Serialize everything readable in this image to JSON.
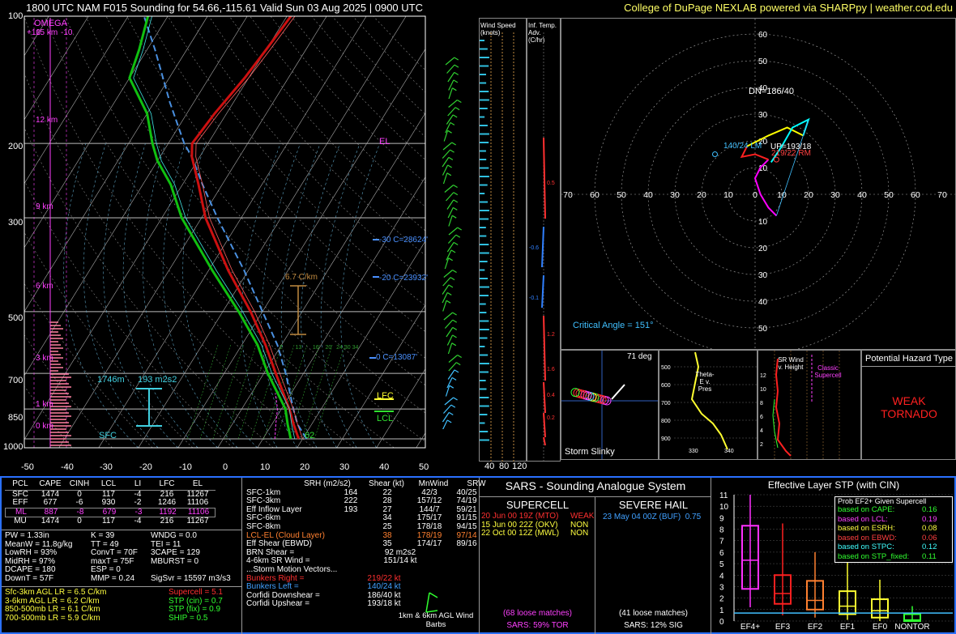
{
  "header": {
    "title": "1800 UTC NAM F015 Sounding for 54.66,-115.61 Valid  Sun 03 Aug 2025 | 0900 UTC",
    "credit": "College of DuPage NEXLAB powered via SHARPpy | weather.cod.edu"
  },
  "colors": {
    "temp": "#cc1010",
    "dew": "#10c010",
    "parcel": "#4a90e0",
    "axis": "#ffffff",
    "gridline": "#cccccc",
    "mixratio": "#30a030",
    "hodo_0_3": "#ff00ff",
    "hodo_3_6": "#ff2020",
    "hodo_6_9": "#ffff00",
    "hodo_9_12": "#00ffff",
    "accent": "#ffff66"
  },
  "skewt": {
    "p_ticks": [
      "100",
      "200",
      "300",
      "500",
      "700",
      "850",
      "1000"
    ],
    "t_ticks": [
      "-50",
      "-40",
      "-30",
      "-20",
      "-10",
      "0",
      "10",
      "20",
      "30",
      "40",
      "50"
    ],
    "height_labels": [
      "15 km",
      "12 km",
      "9 km",
      "6 km",
      "3 km",
      "1 km",
      "0 km"
    ],
    "omega_label": "OMEGA",
    "omega_values": [
      "+10",
      "-10"
    ],
    "lapse_rate": "6.7 C/km",
    "el_label": "EL",
    "lfc_label": "LFC",
    "lcl_label": "LCL",
    "isotherm_labels": [
      "-30 C=28624'",
      "-20 C=23932'",
      "0 C=13087'"
    ],
    "inflow_depth": "1746m",
    "inflow_srh": "193 m2s2",
    "sfc_label": "SFC",
    "sfc_dewpoint": "62",
    "mixratio_labels": [
      "2",
      "4",
      "6",
      "8",
      "10",
      "13",
      "16",
      "20",
      "24",
      "30",
      "34"
    ]
  },
  "windspeed": {
    "title": "Wind Speed (knots)",
    "ticks": [
      "40",
      "80",
      "120"
    ]
  },
  "inftemp": {
    "title": "Inf. Temp. Adv. (C/hr)",
    "values": [
      "0.5",
      "-0.6",
      "-0.1",
      "1.2",
      "1.6",
      "0.4",
      "0.2"
    ]
  },
  "hodograph": {
    "rings": [
      "10",
      "20",
      "30",
      "40",
      "50",
      "60"
    ],
    "x_ticks": [
      "70",
      "60",
      "50",
      "40",
      "30",
      "20",
      "10",
      "0",
      "10",
      "20",
      "30",
      "40",
      "50",
      "60",
      "70"
    ],
    "dn": "DN=186/40",
    "lm": "140/24 LM",
    "up": "UP=193/18",
    "rm": "219/22 RM",
    "mean": "178/19",
    "critical_angle": "Critical Angle = 151°"
  },
  "slinky": {
    "title": "Storm Slinky",
    "angle": "71 deg"
  },
  "thetae": {
    "title": "Theta-E v. Pres",
    "y_ticks": [
      "500",
      "600",
      "700",
      "800",
      "900"
    ],
    "x_ticks": [
      "330",
      "340"
    ]
  },
  "srwind": {
    "title": "SR Wind v. Height",
    "y_ticks": [
      "12",
      "10",
      "8",
      "6",
      "4",
      "2"
    ],
    "classic": "Classic Supercell"
  },
  "hazard": {
    "title": "Potential Hazard Type",
    "value": "WEAK TORNADO"
  },
  "parcels": {
    "headers": [
      "PCL",
      "CAPE",
      "CINH",
      "LCL",
      "LI",
      "LFC",
      "EL"
    ],
    "rows": [
      [
        "SFC",
        "1474",
        "0",
        "117",
        "-4",
        "216",
        "11267"
      ],
      [
        "EFF",
        "677",
        "-6",
        "930",
        "-2",
        "1246",
        "11106"
      ],
      [
        "ML",
        "887",
        "-8",
        "679",
        "-3",
        "1192",
        "11106"
      ],
      [
        "MU",
        "1474",
        "0",
        "117",
        "-4",
        "216",
        "11267"
      ]
    ]
  },
  "indices": {
    "col1": [
      "PW = 1.33in",
      "MeanW = 11.8g/kg",
      "LowRH = 93%",
      "MidRH = 97%",
      "DCAPE = 180",
      "DownT = 57F"
    ],
    "col2": [
      "K = 39",
      "TT = 49",
      "ConvT = 70F",
      "maxT = 75F",
      "ESP = 0",
      "MMP = 0.24"
    ],
    "col3": [
      "WNDG = 0.0",
      "TEI = 11",
      "3CAPE = 129",
      "MBURST = 0",
      "",
      "SigSvr = 15597 m3/s3"
    ]
  },
  "lapse": [
    "Sfc-3km AGL LR = 6.5 C/km",
    "3-6km AGL LR = 6.2 C/km",
    "850-500mb LR = 6.1 C/km",
    "700-500mb LR = 5.9 C/km"
  ],
  "composites": [
    "Supercell = 5.1",
    "STP (cin) = 0.7",
    "STP (fix) = 0.9",
    "SHIP = 0.5"
  ],
  "kinematics": {
    "headers": [
      "SRH (m2/s2)",
      "Shear (kt)",
      "MnWind",
      "SRW"
    ],
    "rows": [
      [
        "SFC-1km",
        "164",
        "22",
        "42/3",
        "40/25"
      ],
      [
        "SFC-3km",
        "222",
        "28",
        "157/12",
        "74/19"
      ],
      [
        "Eff Inflow Layer",
        "193",
        "27",
        "144/7",
        "59/21"
      ],
      [
        "",
        "",
        "",
        "",
        ""
      ],
      [
        "SFC-6km",
        "34",
        "175/17",
        "91/15",
        ""
      ],
      [
        "SFC-8km",
        "25",
        "178/18",
        "94/15",
        ""
      ],
      [
        "LCL-EL (Cloud Layer)",
        "38",
        "178/19",
        "97/14",
        ""
      ],
      [
        "Eff Shear (EBWD)",
        "35",
        "174/17",
        "89/16",
        ""
      ]
    ],
    "brn": "BRN Shear =",
    "brn_val": "92 m2s2",
    "sr46": "4-6km SR Wind =",
    "sr46_val": "151/14 kt",
    "storm_motion": "...Storm Motion Vectors...",
    "bunkers_right": "Bunkers Right =",
    "bunkers_right_val": "219/22 kt",
    "bunkers_left": "Bunkers Left =",
    "bunkers_left_val": "140/24 kt",
    "corfidi_down": "Corfidi Downshear =",
    "corfidi_down_val": "186/40 kt",
    "corfidi_up": "Corfidi Upshear =",
    "corfidi_up_val": "193/18 kt",
    "barbs_label": "1km & 6km AGL Wind Barbs"
  },
  "sars": {
    "title": "SARS - Sounding Analogue System",
    "supercell": "SUPERCELL",
    "hail": "SEVERE HAIL",
    "super_matches": [
      {
        "text": "20 Jun 00 19Z (MTO)",
        "type": "WEAK",
        "color": "#ff3030"
      },
      {
        "text": "15 Jun 00 22Z (OKV)",
        "type": "NON",
        "color": "#ffff40"
      },
      {
        "text": "22 Oct 00 12Z (MWL)",
        "type": "NON",
        "color": "#ffff40"
      }
    ],
    "hail_match": "23 May 04 00Z (BUF)",
    "hail_match_val": "0.75",
    "super_loose": "(68 loose matches)",
    "super_tor": "SARS: 59% TOR",
    "hail_loose": "(41 loose matches)",
    "hail_sig": "SARS: 12% SIG"
  },
  "stp": {
    "title": "Effective Layer STP (with CIN)",
    "y_ticks": [
      "11",
      "10",
      "9",
      "8",
      "7",
      "6",
      "5",
      "4",
      "3",
      "2",
      "1",
      "0"
    ],
    "categories": [
      "EF4+",
      "EF3",
      "EF2",
      "EF1",
      "EF0",
      "NONTOR"
    ],
    "prob_title": "Prob EF2+ Given Supercell",
    "prob_rows": [
      {
        "label": "based on CAPE:",
        "value": "0.16",
        "color": "#30ff30"
      },
      {
        "label": "based on LCL:",
        "value": "0.19",
        "color": "#ff40ff"
      },
      {
        "label": "based on ESRH:",
        "value": "0.08",
        "color": "#ffff40"
      },
      {
        "label": "based on EBWD:",
        "value": "0.06",
        "color": "#ff4040"
      },
      {
        "label": "based on STPC:",
        "value": "0.12",
        "color": "#40ffff"
      },
      {
        "label": "based on STP_fixed:",
        "value": "0.11",
        "color": "#30ff30"
      }
    ],
    "current_value": 0.7
  }
}
